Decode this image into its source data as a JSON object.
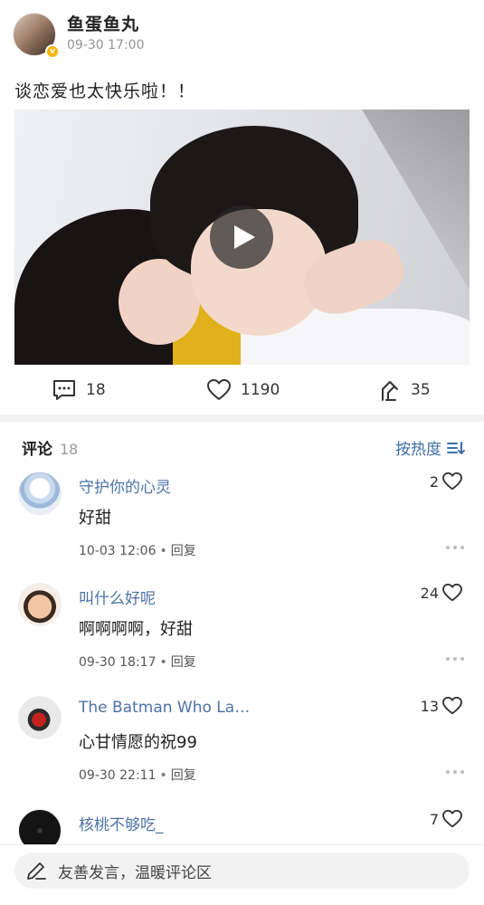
{
  "post": {
    "author": "鱼蛋鱼丸",
    "verified_badge": "v",
    "time": "09-30 17:00",
    "text": "谈恋爱也太快乐啦！！"
  },
  "video": {
    "play_icon": "play-icon"
  },
  "actions": {
    "comments": "18",
    "likes": "1190",
    "reposts": "35"
  },
  "comments_section": {
    "title": "评论",
    "count": "18",
    "sort_label": "按热度"
  },
  "comments": [
    {
      "name": "守护你的心灵",
      "text": "好甜",
      "time": "10-03 12:06",
      "reply": "回复",
      "likes": "2"
    },
    {
      "name": "叫什么好呢",
      "text": "啊啊啊啊，好甜",
      "time": "09-30 18:17",
      "reply": "回复",
      "likes": "24"
    },
    {
      "name": "The Batman Who La…",
      "text": "心甘情愿的祝99",
      "time": "09-30 22:11",
      "reply": "回复",
      "likes": "13"
    },
    {
      "name": "核桃不够吃_",
      "text": "",
      "time": "",
      "reply": "",
      "likes": "7"
    }
  ],
  "input": {
    "placeholder": "友善发言，温暖评论区"
  },
  "colors": {
    "link_blue": "#4d72a8",
    "sort_blue": "#3e6fa6",
    "badge_gold": "#f7b500"
  }
}
